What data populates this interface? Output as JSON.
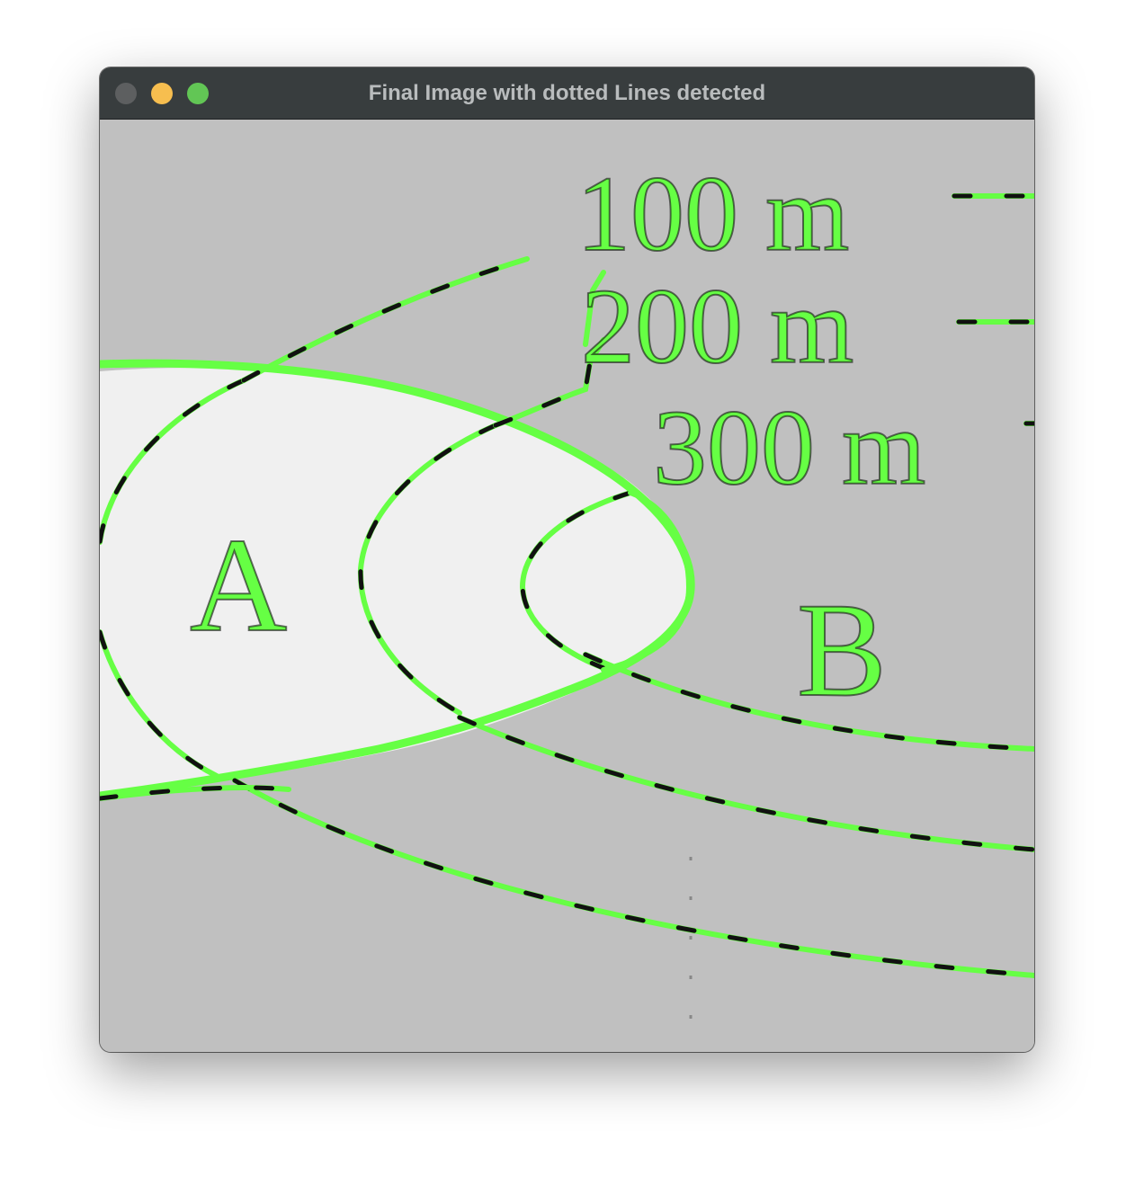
{
  "window": {
    "title": "Final Image with dotted Lines detected",
    "controls": {
      "close_color": "#5d5f60",
      "minimize_color": "#f7be4f",
      "zoom_color": "#62c655"
    }
  },
  "image": {
    "background_color": "#c0c0c0",
    "region_fill_color": "#f0f0f0",
    "detection_color": "#66ff44",
    "dash_color": "#111111",
    "scale_labels": [
      "100 m",
      "200 m",
      "300 m"
    ],
    "point_labels": [
      "A",
      "B"
    ]
  }
}
